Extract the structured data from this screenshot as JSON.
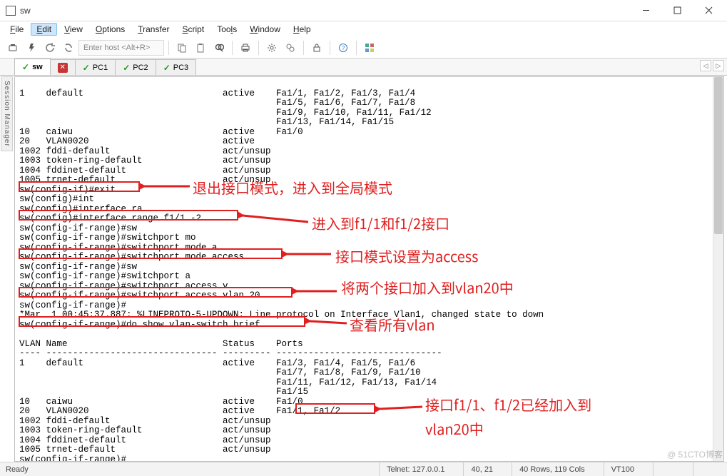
{
  "window": {
    "title": "sw"
  },
  "menu": {
    "file": "File",
    "edit": "Edit",
    "view": "View",
    "options": "Options",
    "transfer": "Transfer",
    "script": "Script",
    "tools": "Tools",
    "window": "Window",
    "help": "Help"
  },
  "toolbar": {
    "host_placeholder": "Enter host <Alt+R>"
  },
  "tabs": [
    {
      "label": "sw",
      "active": true,
      "status": "ok"
    },
    {
      "label": "",
      "active": false,
      "status": "close"
    },
    {
      "label": "PC1",
      "active": false,
      "status": "ok"
    },
    {
      "label": "PC2",
      "active": false,
      "status": "ok"
    },
    {
      "label": "PC3",
      "active": false,
      "status": "ok"
    }
  ],
  "side_label": "Session Manager",
  "terminal": {
    "lines": [
      "",
      "1    default                          active    Fa1/1, Fa1/2, Fa1/3, Fa1/4",
      "                                                Fa1/5, Fa1/6, Fa1/7, Fa1/8",
      "                                                Fa1/9, Fa1/10, Fa1/11, Fa1/12",
      "                                                Fa1/13, Fa1/14, Fa1/15",
      "10   caiwu                            active    Fa1/0",
      "20   VLAN0020                         active",
      "1002 fddi-default                     act/unsup",
      "1003 token-ring-default               act/unsup",
      "1004 fddinet-default                  act/unsup",
      "1005 trnet-default                    act/unsup",
      "sw(config-if)#exit",
      "sw(config)#int",
      "sw(config)#interface ra",
      "sw(config)#interface range f1/1 -2",
      "sw(config-if-range)#sw",
      "sw(config-if-range)#switchport mo",
      "sw(config-if-range)#switchport mode a",
      "sw(config-if-range)#switchport mode access",
      "sw(config-if-range)#sw",
      "sw(config-if-range)#switchport a",
      "sw(config-if-range)#switchport access v",
      "sw(config-if-range)#switchport access vlan 20",
      "sw(config-if-range)#",
      "*Mar  1 00:45:37.887: %LINEPROTO-5-UPDOWN: Line protocol on Interface Vlan1, changed state to down",
      "sw(config-if-range)#do show vlan-switch brief",
      "",
      "VLAN Name                             Status    Ports",
      "---- -------------------------------- --------- -------------------------------",
      "1    default                          active    Fa1/3, Fa1/4, Fa1/5, Fa1/6",
      "                                                Fa1/7, Fa1/8, Fa1/9, Fa1/10",
      "                                                Fa1/11, Fa1/12, Fa1/13, Fa1/14",
      "                                                Fa1/15",
      "10   caiwu                            active    Fa1/0",
      "20   VLAN0020                         active    Fa1/1, Fa1/2",
      "1002 fddi-default                     act/unsup",
      "1003 token-ring-default               act/unsup",
      "1004 fddinet-default                  act/unsup",
      "1005 trnet-default                    act/unsup",
      "sw(config-if-range)#"
    ]
  },
  "status": {
    "ready": "Ready",
    "telnet": "Telnet: 127.0.0.1",
    "pos": "40,  21",
    "size": "40 Rows, 119 Cols",
    "term": "VT100"
  },
  "annotations": {
    "a1": "退出接口模式，进入到全局模式",
    "a2": "进入到f1/1和f1/2接口",
    "a3": "接口模式设置为access",
    "a4": "将两个接口加入到vlan20中",
    "a5": "查看所有vlan",
    "a6_line1": "接口f1/1、f1/2已经加入到",
    "a6_line2": "vlan20中"
  },
  "watermark": "@ 51CTO博客"
}
